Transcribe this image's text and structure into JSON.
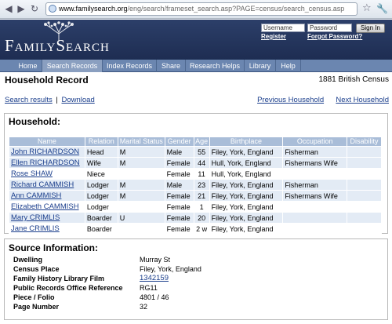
{
  "browser": {
    "url_host": "www.familysearch.org",
    "url_path": "/eng/search/frameset_search.asp?PAGE=census/search_census.asp"
  },
  "header": {
    "logo": "FamilySearch",
    "username_placeholder": "Username",
    "password_placeholder": "Password",
    "signin_label": "Sign In",
    "register_label": "Register",
    "forgot_label": "Forgot Password?"
  },
  "nav": {
    "tabs": [
      {
        "label": "Home"
      },
      {
        "label": "Search Records"
      },
      {
        "label": "Index Records"
      },
      {
        "label": "Share"
      },
      {
        "label": "Research Helps"
      },
      {
        "label": "Library"
      },
      {
        "label": "Help"
      }
    ]
  },
  "page": {
    "title": "Household Record",
    "census": "1881 British Census",
    "search_results_link": "Search results",
    "download_link": "Download",
    "separator": "|",
    "prev_link": "Previous Household",
    "next_link": "Next Household"
  },
  "household": {
    "title": "Household:",
    "columns": [
      "Name",
      "Relation",
      "Marital Status",
      "Gender",
      "Age",
      "Birthplace",
      "Occupation",
      "Disability"
    ],
    "rows": [
      {
        "name": "John RICHARDSON",
        "relation": "Head",
        "marital": "M",
        "gender": "Male",
        "age": "55",
        "birthplace": "Filey, York, England",
        "occupation": "Fisherman",
        "disability": ""
      },
      {
        "name": "Ellen RICHARDSON",
        "relation": "Wife",
        "marital": "M",
        "gender": "Female",
        "age": "44",
        "birthplace": "Hull, York, England",
        "occupation": "Fishermans Wife",
        "disability": ""
      },
      {
        "name": "Rose SHAW",
        "relation": "Niece",
        "marital": "",
        "gender": "Female",
        "age": "11",
        "birthplace": "Hull, York, England",
        "occupation": "",
        "disability": ""
      },
      {
        "name": "Richard CAMMISH",
        "relation": "Lodger",
        "marital": "M",
        "gender": "Male",
        "age": "23",
        "birthplace": "Filey, York, England",
        "occupation": "Fisherman",
        "disability": ""
      },
      {
        "name": "Ann CAMMISH",
        "relation": "Lodger",
        "marital": "M",
        "gender": "Female",
        "age": "21",
        "birthplace": "Filey, York, England",
        "occupation": "Fishermans Wife",
        "disability": ""
      },
      {
        "name": "Elizabeth CAMMISH",
        "relation": "Lodger",
        "marital": "",
        "gender": "Female",
        "age": "1",
        "birthplace": "Filey, York, England",
        "occupation": "",
        "disability": ""
      },
      {
        "name": "Mary CRIMLIS",
        "relation": "Boarder",
        "marital": "U",
        "gender": "Female",
        "age": "20",
        "birthplace": "Filey, York, England",
        "occupation": "",
        "disability": ""
      },
      {
        "name": "Jane CRIMLIS",
        "relation": "Boarder",
        "marital": "",
        "gender": "Female",
        "age": "2 w",
        "birthplace": "Filey, York, England",
        "occupation": "",
        "disability": ""
      }
    ]
  },
  "source": {
    "title": "Source Information:",
    "items": [
      {
        "label": "Dwelling",
        "value": "Murray St"
      },
      {
        "label": "Census Place",
        "value": "Filey, York, England"
      },
      {
        "label": "Family History Library Film",
        "value": "1342159"
      },
      {
        "label": "Public Records Office Reference",
        "value": "RG11"
      },
      {
        "label": "Piece / Folio",
        "value": "4801 / 46"
      },
      {
        "label": "Page Number",
        "value": "32"
      }
    ]
  },
  "colors": {
    "header_bg": "#24355d",
    "nav_bg": "#6b86b0",
    "table_header_bg": "#a9bdd8",
    "row_shade": "#e3ebf5",
    "link": "#1a3e8c"
  }
}
